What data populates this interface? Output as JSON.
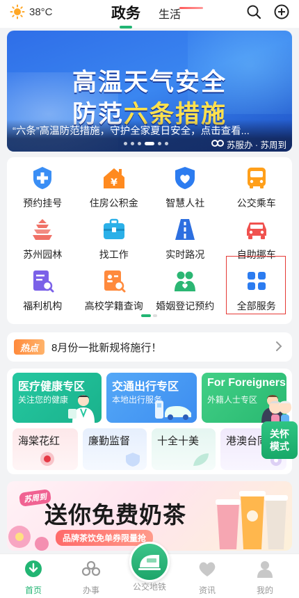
{
  "header": {
    "weather_temp": "38°C",
    "tab_active": "政务",
    "tab_other": "生活"
  },
  "banner": {
    "line1": "高温天气安全",
    "line2_pre": "防范",
    "line2_highlight": "六条措施",
    "caption": "“六条”高温防范措施，守护全家夏日安全，点击查看...",
    "source": "苏服办 · 苏周到",
    "slide_count": 6,
    "active_slide": 4
  },
  "services": {
    "items": [
      {
        "label": "预约挂号",
        "icon": "medical-cross-icon"
      },
      {
        "label": "住房公积金",
        "icon": "house-yen-icon"
      },
      {
        "label": "智慧人社",
        "icon": "shield-heart-icon"
      },
      {
        "label": "公交乘车",
        "icon": "bus-icon"
      },
      {
        "label": "苏州园林",
        "icon": "pagoda-icon"
      },
      {
        "label": "找工作",
        "icon": "briefcase-icon"
      },
      {
        "label": "实时路况",
        "icon": "road-icon"
      },
      {
        "label": "自助挪车",
        "icon": "car-icon"
      },
      {
        "label": "福利机构",
        "icon": "document-search-icon"
      },
      {
        "label": "高校学籍查询",
        "icon": "profile-search-icon"
      },
      {
        "label": "婚姻登记预约",
        "icon": "couple-icon"
      },
      {
        "label": "全部服务",
        "icon": "grid-icon"
      }
    ]
  },
  "notice": {
    "tag": "热点",
    "text": "8月份一批新规将施行！"
  },
  "zones": {
    "big": [
      {
        "title": "医疗健康专区",
        "subtitle": "关注您的健康"
      },
      {
        "title": "交通出行专区",
        "subtitle": "本地出行服务"
      },
      {
        "title": "For Foreigners",
        "subtitle": "外籍人士专区"
      }
    ],
    "small": [
      {
        "title": "海棠花红"
      },
      {
        "title": "廉勤监督"
      },
      {
        "title": "十全十美"
      },
      {
        "title": "港澳台同"
      }
    ]
  },
  "float_button": {
    "line1": "关怀",
    "line2": "模式"
  },
  "promo": {
    "ribbon": "苏周到",
    "headline": "送你免费奶茶",
    "sub": "品牌茶饮免单券限量抢"
  },
  "bottom_nav": {
    "home": "首页",
    "affairs": "办事",
    "transit": "公交地铁",
    "news": "资讯",
    "mine": "我的"
  },
  "colors": {
    "accent": "#22b573",
    "banner_bg": "#2f6ee8",
    "highlight_box": "#e53935"
  }
}
